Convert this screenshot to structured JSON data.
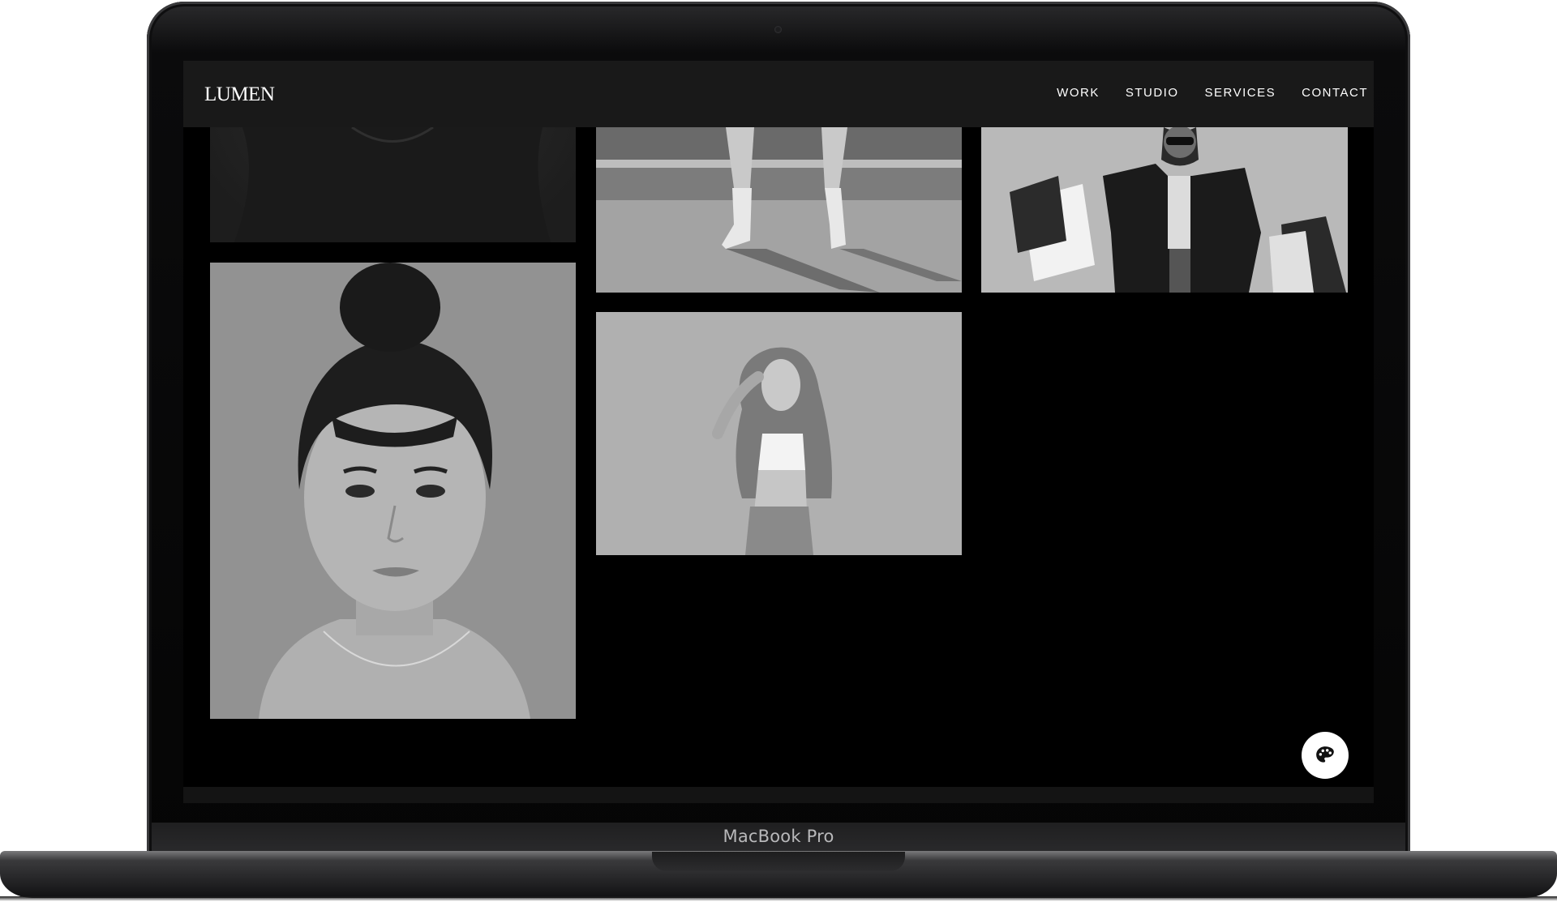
{
  "site": {
    "logo": "LUMEN",
    "nav": [
      {
        "label": "WORK"
      },
      {
        "label": "STUDIO"
      },
      {
        "label": "SERVICES"
      },
      {
        "label": "CONTACT"
      }
    ]
  },
  "gallery": {
    "photos": [
      {
        "icon": "photo-dark-garment"
      },
      {
        "icon": "photo-boots-street"
      },
      {
        "icon": "photo-woman-shopping-bags"
      },
      {
        "icon": "photo-woman-portrait"
      },
      {
        "icon": "photo-woman-wavy-hair"
      }
    ]
  },
  "fab": {
    "icon": "palette-icon"
  },
  "device": {
    "brand": "MacBook Pro"
  }
}
